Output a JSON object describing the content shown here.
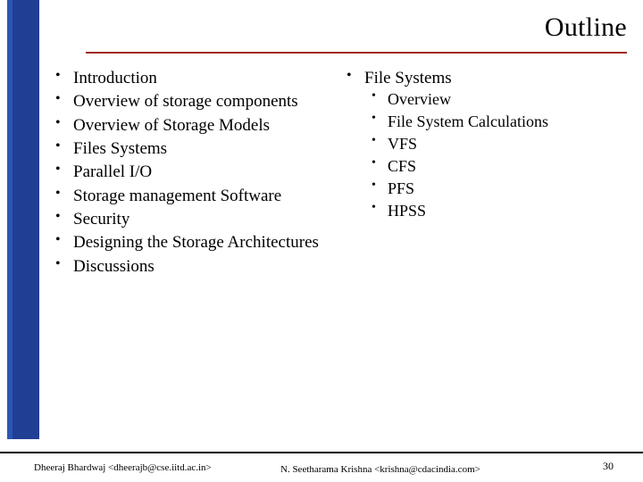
{
  "slide": {
    "title": "Outline",
    "accent_rule_color": "#9e2a1e",
    "sidebar_color": "#1f3f94",
    "columns": {
      "left": [
        {
          "text": "Introduction",
          "children": []
        },
        {
          "text": "Overview of storage components",
          "children": []
        },
        {
          "text": "Overview of Storage Models",
          "children": []
        },
        {
          "text": "Files Systems",
          "children": []
        },
        {
          "text": "Parallel I/O",
          "children": []
        },
        {
          "text": "Storage management Software",
          "children": []
        },
        {
          "text": "Security",
          "children": []
        },
        {
          "text": "Designing the Storage Architectures",
          "children": []
        },
        {
          "text": "Discussions",
          "children": []
        }
      ],
      "right": [
        {
          "text": "File Systems",
          "children": [
            "Overview",
            "File System Calculations",
            "VFS",
            "CFS",
            "PFS",
            "HPSS"
          ]
        }
      ]
    }
  },
  "footer": {
    "left": "Dheeraj Bhardwaj <dheerajb@cse.iitd.ac.in>",
    "center": "N. Seetharama Krishna <krishna@cdacindia.com>",
    "page_number": "30"
  }
}
